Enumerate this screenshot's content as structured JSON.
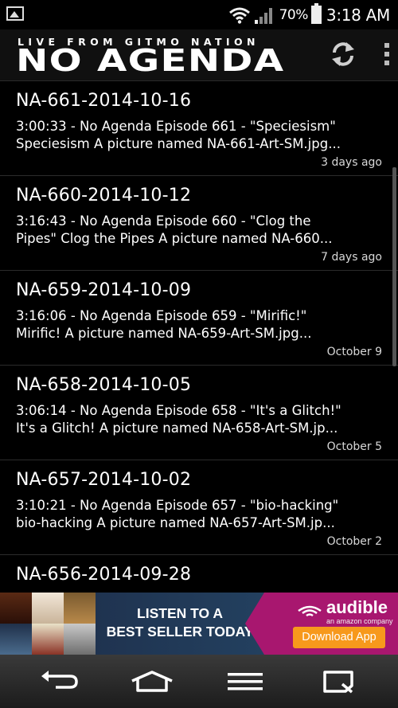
{
  "status_bar": {
    "battery_percent": "70%",
    "time": "3:18 AM",
    "icons": [
      "image-notification-icon",
      "wifi-icon",
      "signal-icon",
      "battery-icon"
    ]
  },
  "app_bar": {
    "tagline": "LIVE FROM GITMO NATION",
    "logo": "NO AGENDA",
    "actions": [
      "refresh-icon",
      "overflow-menu-icon"
    ]
  },
  "episodes": [
    {
      "title": "NA-661-2014-10-16",
      "desc_line1": "3:00:33 - No Agenda Episode 661 - \"Speciesism\"",
      "desc_line2": "Speciesism A picture named NA-661-Art-SM.jpg...",
      "date": "3 days ago"
    },
    {
      "title": "NA-660-2014-10-12",
      "desc_line1": "3:16:43 - No Agenda Episode 660 - \"Clog the",
      "desc_line2": "Pipes\" Clog the Pipes A picture named NA-660...",
      "date": "7 days ago"
    },
    {
      "title": "NA-659-2014-10-09",
      "desc_line1": "3:16:06 - No Agenda Episode 659 - \"Mirific!\"",
      "desc_line2": "Mirific! A picture named NA-659-Art-SM.jpg...",
      "date": "October 9"
    },
    {
      "title": "NA-658-2014-10-05",
      "desc_line1": "3:06:14 - No Agenda Episode 658 - \"It's a Glitch!\"",
      "desc_line2": "It's a Glitch! A picture named NA-658-Art-SM.jp...",
      "date": "October 5"
    },
    {
      "title": "NA-657-2014-10-02",
      "desc_line1": "3:10:21 - No Agenda Episode 657 - \"bio-hacking\"",
      "desc_line2": "bio-hacking A picture named NA-657-Art-SM.jp...",
      "date": "October 2"
    },
    {
      "title": "NA-656-2014-09-28",
      "desc_line1": "",
      "desc_line2": "",
      "date": ""
    }
  ],
  "ad": {
    "line1": "LISTEN TO A",
    "line2": "BEST SELLER TODAY",
    "brand": "audible",
    "brand_sub": "an amazon company",
    "button": "Download App",
    "colors": {
      "brand": "#a8176f",
      "button": "#f7991c",
      "center": "#1f3350"
    }
  },
  "nav_bar": {
    "buttons": [
      "back-icon",
      "home-icon",
      "menu-icon",
      "recent-apps-icon"
    ]
  }
}
